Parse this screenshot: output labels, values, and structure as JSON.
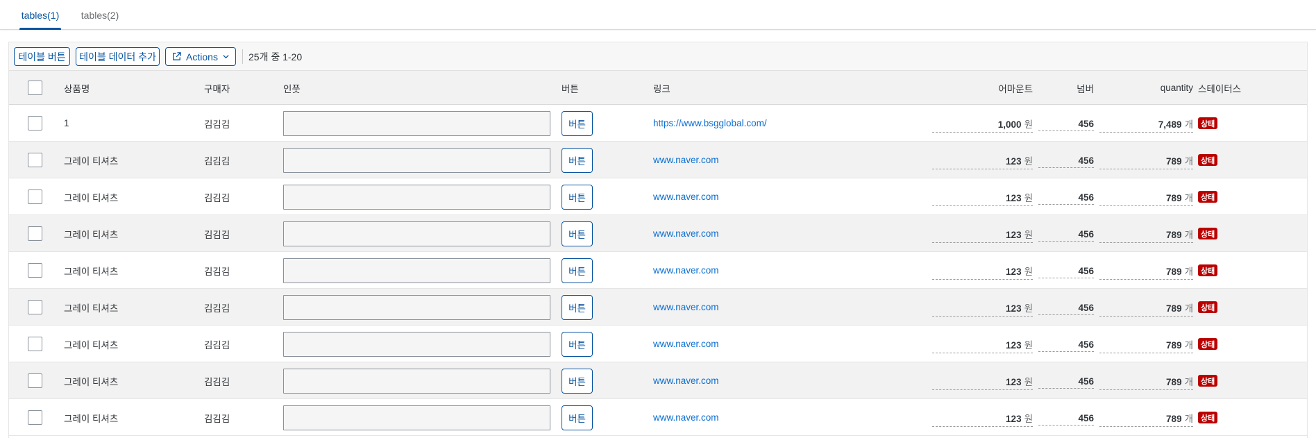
{
  "tabs": [
    {
      "label": "tables(1)",
      "selected": true
    },
    {
      "label": "tables(2)",
      "selected": false
    }
  ],
  "toolbar": {
    "table_button_label": "테이블 버튼",
    "add_data_button_label": "테이블 데이터 추가",
    "actions_button_label": "Actions",
    "count_text": "25개 중 1-20"
  },
  "columns": {
    "product": "상품명",
    "buyer": "구매자",
    "input": "인풋",
    "button": "버튼",
    "link": "링크",
    "amount": "어마운트",
    "number": "넘버",
    "quantity": "quantity",
    "status": "스테이터스"
  },
  "rows": [
    {
      "product": "1",
      "buyer": "김김김",
      "button": "버튼",
      "link": "https://www.bsgglobal.com/",
      "amount": "1,000",
      "amount_unit": "원",
      "number": "456",
      "quantity": "7,489",
      "quantity_unit": "개",
      "status": "상태"
    },
    {
      "product": "그레이 티셔츠",
      "buyer": "김김김",
      "button": "버튼",
      "link": "www.naver.com",
      "amount": "123",
      "amount_unit": "원",
      "number": "456",
      "quantity": "789",
      "quantity_unit": "개",
      "status": "상태"
    },
    {
      "product": "그레이 티셔츠",
      "buyer": "김김김",
      "button": "버튼",
      "link": "www.naver.com",
      "amount": "123",
      "amount_unit": "원",
      "number": "456",
      "quantity": "789",
      "quantity_unit": "개",
      "status": "상태"
    },
    {
      "product": "그레이 티셔츠",
      "buyer": "김김김",
      "button": "버튼",
      "link": "www.naver.com",
      "amount": "123",
      "amount_unit": "원",
      "number": "456",
      "quantity": "789",
      "quantity_unit": "개",
      "status": "상태"
    },
    {
      "product": "그레이 티셔츠",
      "buyer": "김김김",
      "button": "버튼",
      "link": "www.naver.com",
      "amount": "123",
      "amount_unit": "원",
      "number": "456",
      "quantity": "789",
      "quantity_unit": "개",
      "status": "상태"
    },
    {
      "product": "그레이 티셔츠",
      "buyer": "김김김",
      "button": "버튼",
      "link": "www.naver.com",
      "amount": "123",
      "amount_unit": "원",
      "number": "456",
      "quantity": "789",
      "quantity_unit": "개",
      "status": "상태"
    },
    {
      "product": "그레이 티셔츠",
      "buyer": "김김김",
      "button": "버튼",
      "link": "www.naver.com",
      "amount": "123",
      "amount_unit": "원",
      "number": "456",
      "quantity": "789",
      "quantity_unit": "개",
      "status": "상태"
    },
    {
      "product": "그레이 티셔츠",
      "buyer": "김김김",
      "button": "버튼",
      "link": "www.naver.com",
      "amount": "123",
      "amount_unit": "원",
      "number": "456",
      "quantity": "789",
      "quantity_unit": "개",
      "status": "상태"
    },
    {
      "product": "그레이 티셔츠",
      "buyer": "김김김",
      "button": "버튼",
      "link": "www.naver.com",
      "amount": "123",
      "amount_unit": "원",
      "number": "456",
      "quantity": "789",
      "quantity_unit": "개",
      "status": "상태"
    }
  ],
  "colors": {
    "accent": "#0854a0",
    "link": "#0a6ed1",
    "status_badge": "#bb0000",
    "row_alt": "#f2f2f2"
  },
  "icons": {
    "actions": "share-external-icon",
    "actions_caret": "chevron-down-icon"
  }
}
